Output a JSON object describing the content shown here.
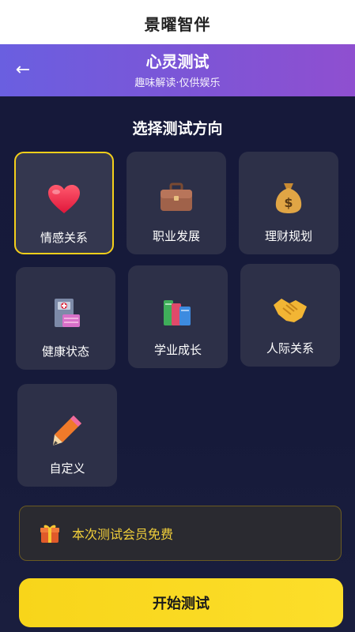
{
  "app": {
    "title": "景曜智伴"
  },
  "header": {
    "back_icon": "arrow-left-icon",
    "title": "心灵测试",
    "subtitle": "趣味解读·仅供娱乐",
    "gradient": [
      "#6a5fe0",
      "#8f4fd0"
    ]
  },
  "main": {
    "section_title": "选择测试方向",
    "categories": [
      {
        "label": "情感关系",
        "icon": "heart-icon",
        "selected": true
      },
      {
        "label": "职业发展",
        "icon": "briefcase-icon",
        "selected": false
      },
      {
        "label": "理财规划",
        "icon": "money-bag-icon",
        "selected": false
      },
      {
        "label": "健康状态",
        "icon": "hospital-icon",
        "selected": false
      },
      {
        "label": "学业成长",
        "icon": "books-icon",
        "selected": false
      },
      {
        "label": "人际关系",
        "icon": "handshake-icon",
        "selected": false
      },
      {
        "label": "自定义",
        "icon": "pencil-icon",
        "selected": false
      }
    ],
    "banner": {
      "icon": "gift-icon",
      "text": "本次测试会员免费"
    },
    "start_button": "开始测试",
    "accent": "#f4cf1a",
    "background": "#16193a"
  }
}
